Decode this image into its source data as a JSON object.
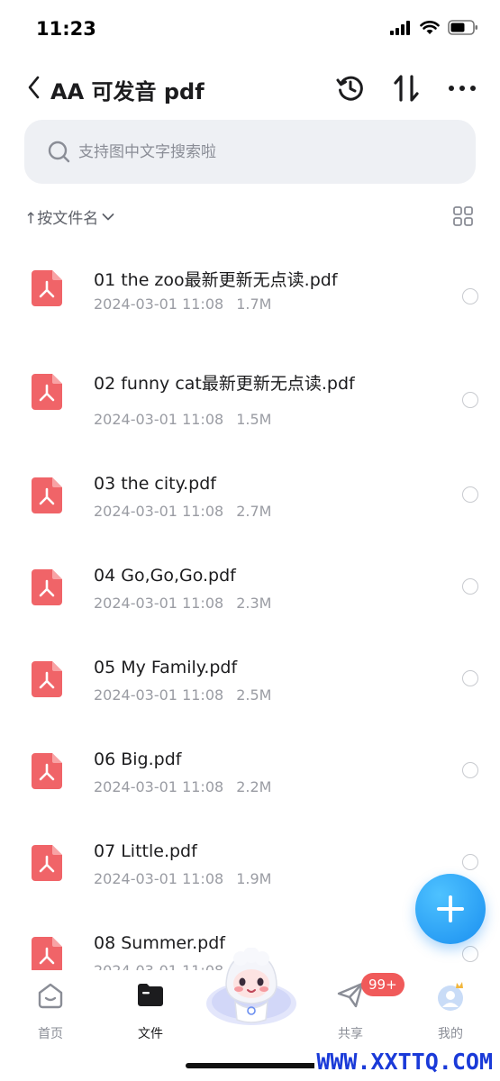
{
  "status_bar": {
    "time": "11:23"
  },
  "nav": {
    "title": "AA 可发音 pdf"
  },
  "search": {
    "placeholder": "支持图中文字搜索啦"
  },
  "sort": {
    "label": "↑按文件名"
  },
  "files": [
    {
      "name": "01 the zoo最新更新无点读.pdf",
      "date": "2024-03-01 11:08",
      "size": "1.7M"
    },
    {
      "name": "02 funny cat最新更新无点读.pdf",
      "date": "2024-03-01 11:08",
      "size": "1.5M"
    },
    {
      "name": "03 the city.pdf",
      "date": "2024-03-01 11:08",
      "size": "2.7M"
    },
    {
      "name": "04 Go,Go,Go.pdf",
      "date": "2024-03-01 11:08",
      "size": "2.3M"
    },
    {
      "name": "05 My Family.pdf",
      "date": "2024-03-01 11:08",
      "size": "2.5M"
    },
    {
      "name": "06 Big.pdf",
      "date": "2024-03-01 11:08",
      "size": "2.2M"
    },
    {
      "name": "07 Little.pdf",
      "date": "2024-03-01 11:08",
      "size": "1.9M"
    },
    {
      "name": "08 Summer.pdf",
      "date": "2024-03-01 11:08",
      "size": ""
    }
  ],
  "tabbar": {
    "home": "首页",
    "files": "文件",
    "share": "共享",
    "mine": "我的",
    "share_badge": "99+"
  },
  "watermark": "WWW.XXTTQ.COM",
  "colors": {
    "accent": "#1a8ff0",
    "pdf_icon": "#f06468",
    "badge": "#f05a5a"
  }
}
